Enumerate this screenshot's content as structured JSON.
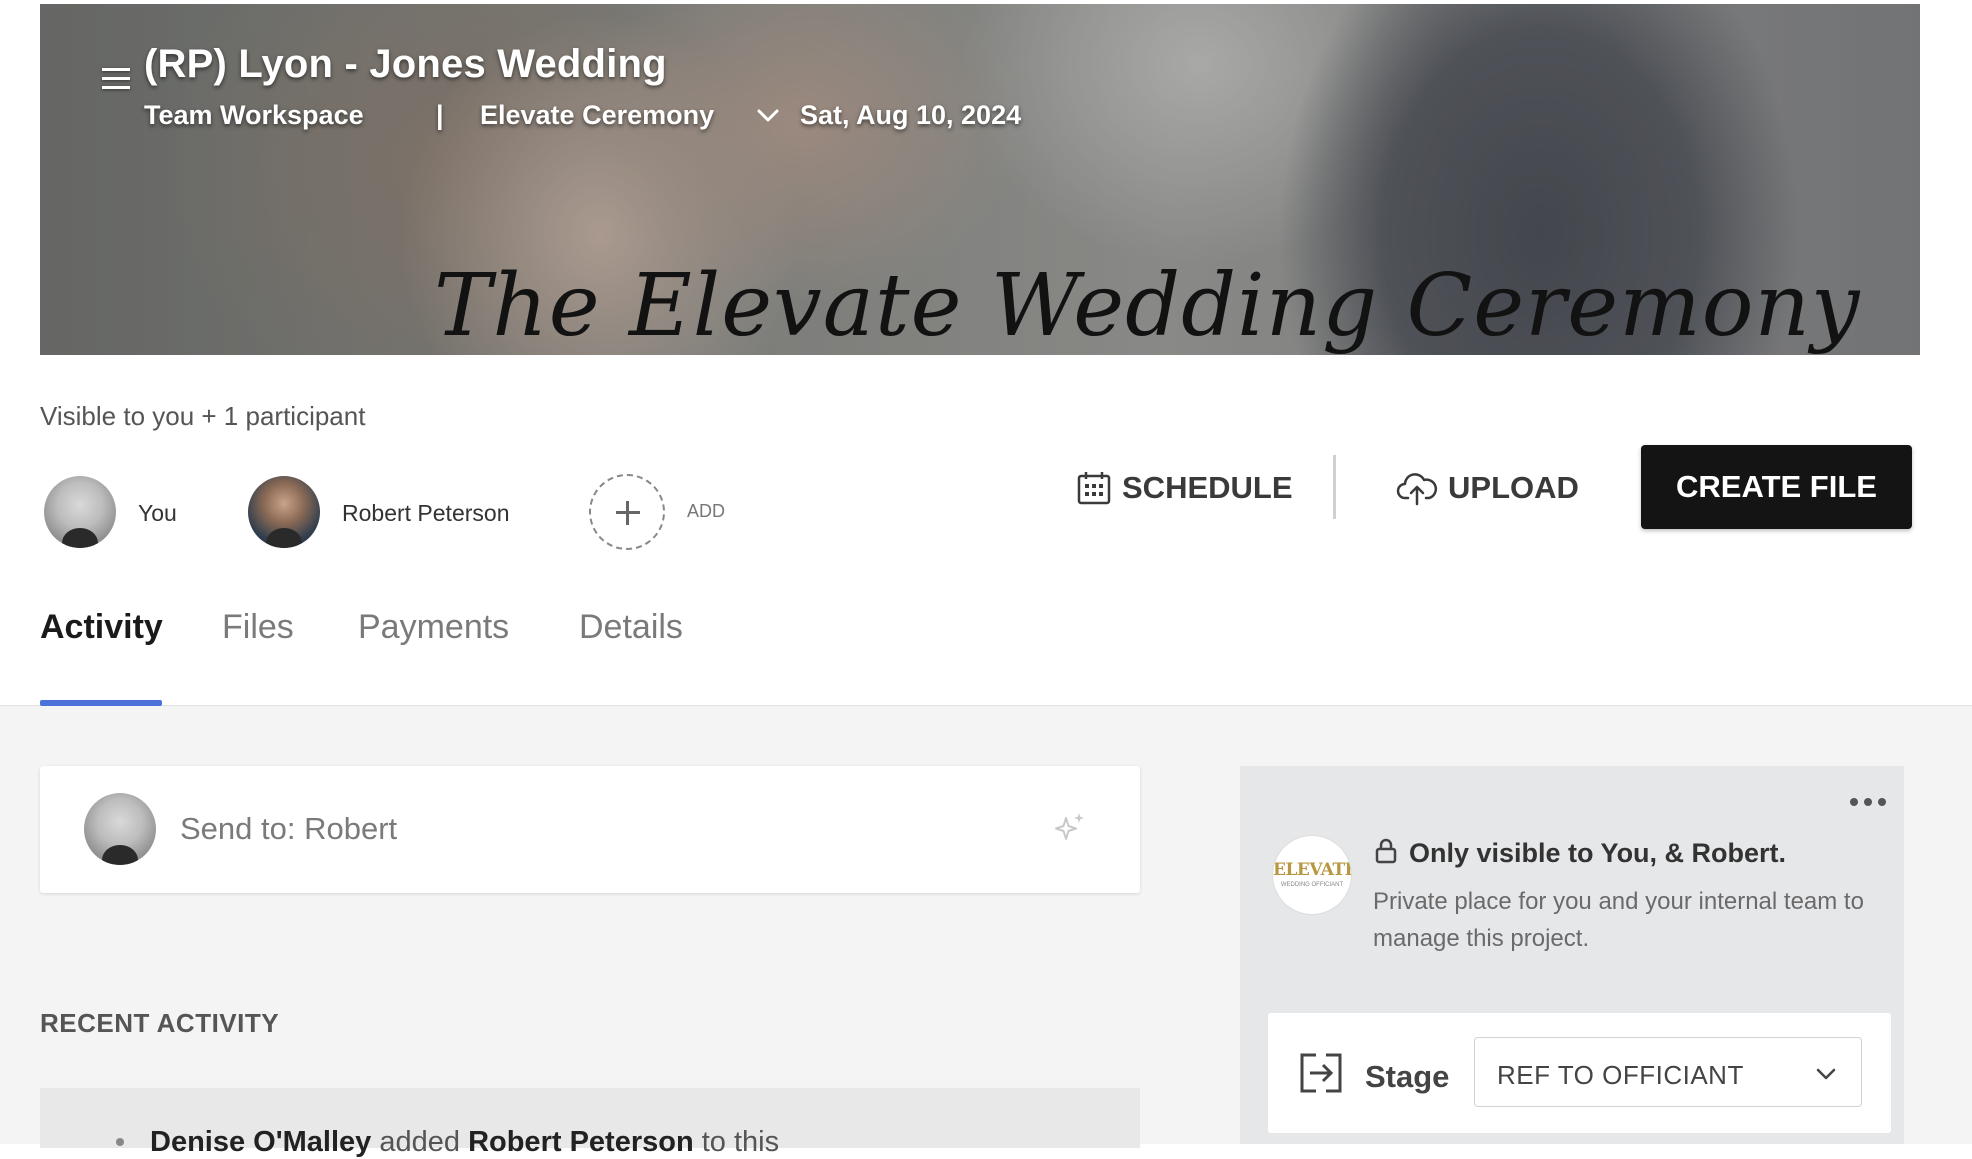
{
  "header": {
    "project_title": "(RP) Lyon - Jones Wedding",
    "workspace": "Team Workspace",
    "separator": "|",
    "event_name": "Elevate Ceremony",
    "event_date": "Sat, Aug 10, 2024",
    "banner_script": "The Elevate Wedding Ceremony"
  },
  "participants": {
    "visibility_label": "Visible to you + 1 participant",
    "people": [
      {
        "name": "You"
      },
      {
        "name": "Robert Peterson"
      }
    ],
    "add_label": "ADD"
  },
  "actions": {
    "schedule_label": "SCHEDULE",
    "upload_label": "UPLOAD",
    "create_file_label": "CREATE FILE"
  },
  "tabs": [
    {
      "label": "Activity",
      "active": true
    },
    {
      "label": "Files",
      "active": false
    },
    {
      "label": "Payments",
      "active": false
    },
    {
      "label": "Details",
      "active": false
    }
  ],
  "composer": {
    "placeholder": "Send to: Robert"
  },
  "recent_activity": {
    "heading": "RECENT ACTIVITY",
    "first_item": {
      "actor": "Denise O'Malley",
      "verb": "added",
      "target": "Robert Peterson",
      "suffix": "to this"
    }
  },
  "side_panel": {
    "logo_text": "ELEVATE",
    "logo_subtext": "WEDDING OFFICIANT",
    "visibility_title": "Only visible to You, & Robert.",
    "visibility_description": "Private place for you and your internal team to manage this project.",
    "stage_label": "Stage",
    "stage_value": "REF TO OFFICIANT"
  },
  "colors": {
    "accent_tab": "#4a72d9",
    "primary_button": "#141414"
  }
}
